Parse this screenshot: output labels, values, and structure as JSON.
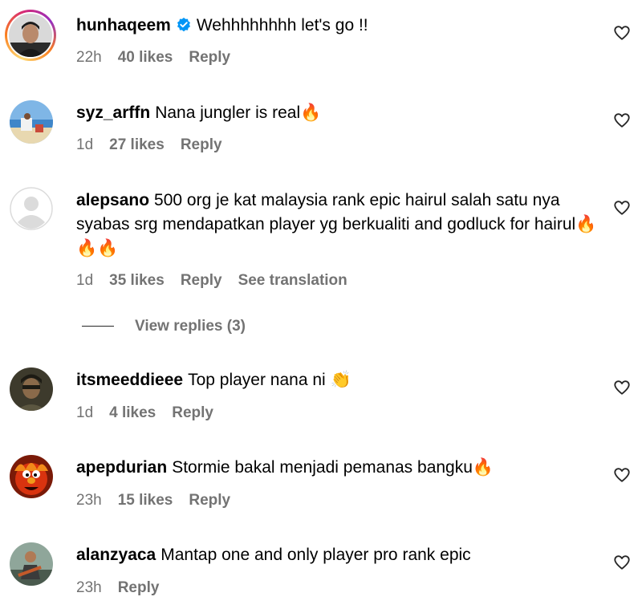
{
  "colors": {
    "secondary_text": "#737373",
    "verified_blue": "#0095f6"
  },
  "comments": [
    {
      "username": "hunhaqeem",
      "verified": true,
      "text": "Wehhhhhhhh let's go !!",
      "time": "22h",
      "likes": "40 likes",
      "reply": "Reply"
    },
    {
      "username": "syz_arffn",
      "text": "Nana jungler is real🔥",
      "time": "1d",
      "likes": "27 likes",
      "reply": "Reply"
    },
    {
      "username": "alepsano",
      "text": "500 org je kat malaysia rank epic hairul salah satu nya syabas srg mendapatkan player yg berkualiti and godluck for hairul🔥🔥🔥",
      "time": "1d",
      "likes": "35 likes",
      "reply": "Reply",
      "translation": "See translation",
      "view_replies": "View replies (3)"
    },
    {
      "username": "itsmeeddieee",
      "text": "Top player nana ni 👏",
      "time": "1d",
      "likes": "4 likes",
      "reply": "Reply"
    },
    {
      "username": "apepdurian",
      "text": "Stormie bakal menjadi pemanas bangku🔥",
      "time": "23h",
      "likes": "15 likes",
      "reply": "Reply"
    },
    {
      "username": "alanzyaca",
      "text": "Mantap one and only player pro rank epic",
      "time": "23h",
      "reply": "Reply"
    }
  ],
  "icons": {
    "like": "heart-outline-icon",
    "verified": "verified-badge-icon"
  }
}
